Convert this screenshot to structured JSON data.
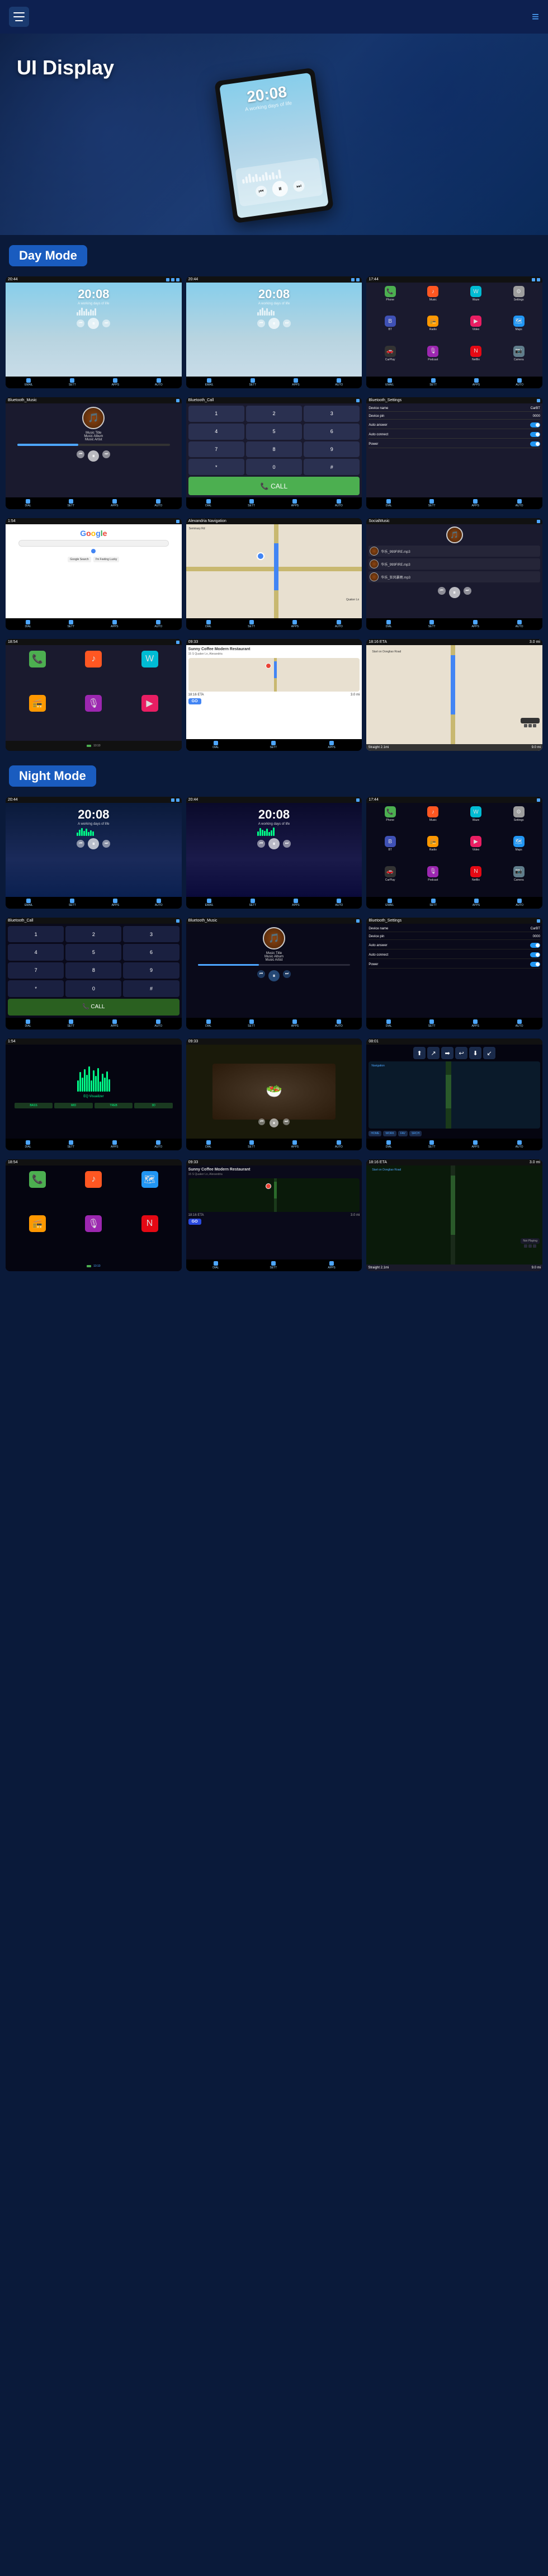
{
  "header": {
    "menu_icon": "☰",
    "nav_icon": "≡",
    "title": "UI Display"
  },
  "hero": {
    "title": "UI Display",
    "device_time": "20:08",
    "device_time_sub": "A working days of life"
  },
  "day_mode": {
    "label": "Day Mode",
    "screens": [
      {
        "type": "home",
        "time": "20:08",
        "sub": "A working days of life"
      },
      {
        "type": "home2",
        "time": "20:08",
        "sub": "A working days of life"
      },
      {
        "type": "apps"
      },
      {
        "type": "music",
        "title": "Music Title",
        "album": "Music Album",
        "artist": "Music Artist"
      },
      {
        "type": "call"
      },
      {
        "type": "settings",
        "title": "Bluetooth_Settings",
        "rows": [
          {
            "label": "Device name",
            "value": "CarBT"
          },
          {
            "label": "Device pin",
            "value": "0000"
          },
          {
            "label": "Auto answer",
            "value": "toggle"
          },
          {
            "label": "Auto connect",
            "value": "toggle"
          },
          {
            "label": "Power",
            "value": "toggle"
          }
        ]
      },
      {
        "type": "google"
      },
      {
        "type": "map"
      },
      {
        "type": "social"
      },
      {
        "type": "localinfo",
        "name": "Sunny Coffee Modern Restaurant",
        "address": "15 S Quaker Ln, Alexandria"
      },
      {
        "type": "routenav"
      },
      {
        "type": "notplaying"
      }
    ]
  },
  "night_mode": {
    "label": "Night Mode",
    "screens": [
      {
        "type": "home-night",
        "time": "20:08",
        "sub": "A working days of life"
      },
      {
        "type": "home-night2",
        "time": "20:08",
        "sub": "A working days of life"
      },
      {
        "type": "apps-night"
      },
      {
        "type": "call-night",
        "title": "Bluetooth_Call"
      },
      {
        "type": "music-night",
        "title": "Bluetooth_Music",
        "album": "Music Album",
        "artist": "Music Artist"
      },
      {
        "type": "settings-night",
        "title": "Bluetooth_Settings"
      },
      {
        "type": "eq-night"
      },
      {
        "type": "video-night"
      },
      {
        "type": "nav-night"
      },
      {
        "type": "localinfo-night",
        "name": "Sunny Coffee Modern Restaurant"
      },
      {
        "type": "routenav-night"
      },
      {
        "type": "notplaying-night"
      }
    ]
  },
  "app_icons": [
    {
      "label": "Phone",
      "emoji": "📞",
      "class": "app-phone"
    },
    {
      "label": "Music",
      "emoji": "♪",
      "class": "app-music"
    },
    {
      "label": "Maps",
      "emoji": "🗺",
      "class": "app-maps"
    },
    {
      "label": "Settings",
      "emoji": "⚙",
      "class": "app-settings"
    },
    {
      "label": "BT",
      "emoji": "B",
      "class": "app-bt"
    },
    {
      "label": "Radio",
      "emoji": "📻",
      "class": "app-radio"
    },
    {
      "label": "Video",
      "emoji": "▶",
      "class": "app-video"
    },
    {
      "label": "Camera",
      "emoji": "📷",
      "class": "app-camera"
    },
    {
      "label": "Podcast",
      "emoji": "🎙",
      "class": "app-podcast"
    },
    {
      "label": "Netflix",
      "emoji": "N",
      "class": "app-netflix"
    },
    {
      "label": "Waze",
      "emoji": "W",
      "class": "app-waze"
    },
    {
      "label": "CarPlay",
      "emoji": "🚗",
      "class": "app-carplay"
    }
  ]
}
